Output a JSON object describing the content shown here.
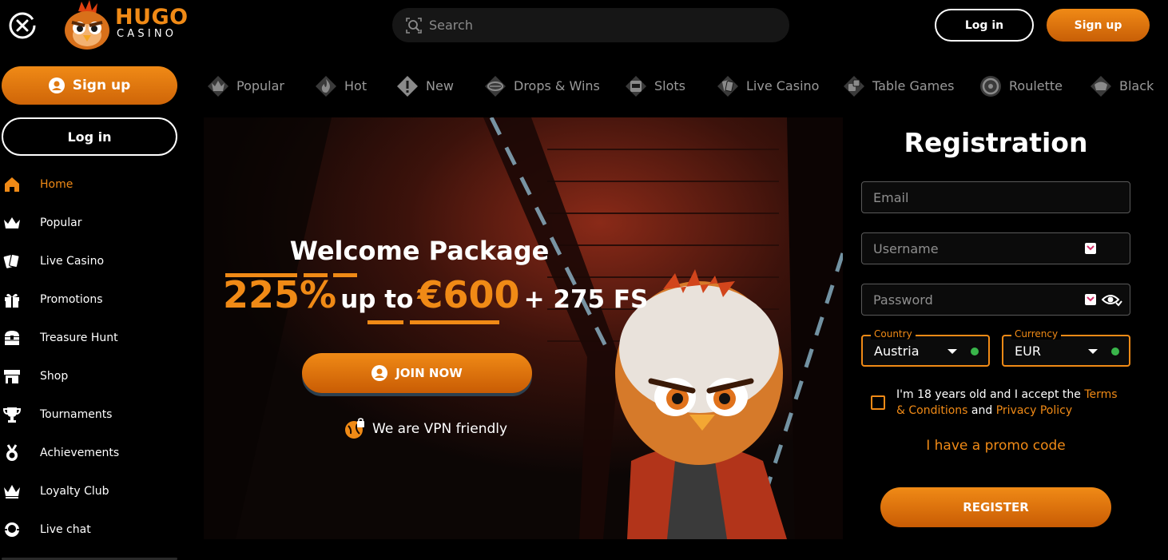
{
  "header": {
    "logo_text": "HUGO",
    "logo_subtext": "CASINO",
    "search_placeholder": "Search",
    "login_label": "Log in",
    "signup_label": "Sign up"
  },
  "sidebar": {
    "signup_label": "Sign up",
    "login_label": "Log in",
    "items": [
      {
        "label": "Home",
        "icon": "home-icon",
        "active": true
      },
      {
        "label": "Popular",
        "icon": "crown-icon"
      },
      {
        "label": "Live Casino",
        "icon": "cards-icon"
      },
      {
        "label": "Promotions",
        "icon": "gift-icon"
      },
      {
        "label": "Treasure Hunt",
        "icon": "treasure-chest-icon"
      },
      {
        "label": "Shop",
        "icon": "shop-icon"
      },
      {
        "label": "Tournaments",
        "icon": "trophy-icon"
      },
      {
        "label": "Achievements",
        "icon": "medal-icon"
      },
      {
        "label": "Loyalty Club",
        "icon": "crown-icon"
      },
      {
        "label": "Live chat",
        "icon": "chat-icon"
      }
    ]
  },
  "categories": [
    {
      "label": "Popular",
      "icon": "crown-icon"
    },
    {
      "label": "Hot",
      "icon": "flame-icon"
    },
    {
      "label": "New",
      "icon": "exclamation-icon"
    },
    {
      "label": "Drops & Wins",
      "icon": "drops-wins-icon"
    },
    {
      "label": "Slots",
      "icon": "slot-machine-icon"
    },
    {
      "label": "Live Casino",
      "icon": "cards-icon"
    },
    {
      "label": "Table Games",
      "icon": "dice-icon"
    },
    {
      "label": "Roulette",
      "icon": "roulette-icon"
    },
    {
      "label": "Black",
      "icon": "blackjack-icon"
    }
  ],
  "hero": {
    "title": "Welcome Package",
    "percent": "225%",
    "up_to": "up to",
    "amount": "€600",
    "free_spins": "+ 275 FS",
    "join_label": "JOIN NOW",
    "vpn_text": "We are VPN friendly"
  },
  "registration": {
    "title": "Registration",
    "email_placeholder": "Email",
    "username_placeholder": "Username",
    "password_placeholder": "Password",
    "country_label": "Country",
    "country_value": "Austria",
    "currency_label": "Currency",
    "currency_value": "EUR",
    "terms_prefix": "I'm 18 years old and I accept the ",
    "terms_link": "Terms & Conditions",
    "terms_and": " and ",
    "privacy_link": "Privacy Policy",
    "promo_code_label": "I have a promo code",
    "register_label": "REGISTER"
  },
  "colors": {
    "accent": "#f08a16",
    "background": "#000000",
    "muted_text": "#9a9a9a",
    "valid_dot": "#39b54a"
  }
}
